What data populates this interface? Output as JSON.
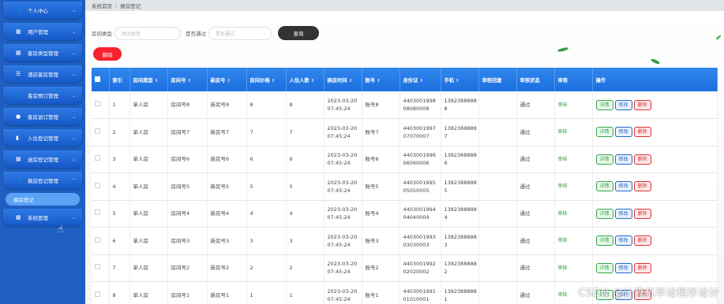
{
  "sidebar": {
    "items": [
      {
        "icon": "user-icon",
        "glyph": "👤",
        "label": "个人中心",
        "arrow": "⌄"
      },
      {
        "icon": "grid-icon",
        "glyph": "▦",
        "label": "用户管理",
        "arrow": "⌄"
      },
      {
        "icon": "grid-icon",
        "glyph": "▦",
        "label": "客房类型管理",
        "arrow": "⌄"
      },
      {
        "icon": "sliders-icon",
        "glyph": "☰",
        "label": "酒店客房管理",
        "arrow": "⌄"
      },
      {
        "icon": "user-icon",
        "glyph": "👤",
        "label": "客房预订管理",
        "arrow": "⌄"
      },
      {
        "icon": "location-pin-icon",
        "glyph": "●",
        "label": "客房退订管理",
        "arrow": "⌄"
      },
      {
        "icon": "document-icon",
        "glyph": "▮",
        "label": "入住登记管理",
        "arrow": "⌄"
      },
      {
        "icon": "grid-icon",
        "glyph": "▦",
        "label": "退房登记管理",
        "arrow": "⌄"
      },
      {
        "icon": "user-icon",
        "glyph": "👤",
        "label": "换房登记管理",
        "arrow": "⌃"
      }
    ],
    "submenu_active": "换房登记",
    "last_item": {
      "icon": "grid-icon",
      "glyph": "▦",
      "label": "系统管理",
      "arrow": "⌄"
    }
  },
  "breadcrumb": {
    "home": "系统首页",
    "sep": "/",
    "current": "换房登记"
  },
  "search": {
    "room_type_label": "房间类型",
    "room_type_placeholder": "房间类型",
    "passed_label": "是否通过",
    "passed_placeholder": "是否通过",
    "search_button": "查询"
  },
  "delete_button": "删除",
  "table": {
    "headers": [
      "索引",
      "房间类型",
      "房间号",
      "新房号",
      "房间价格",
      "入住人数",
      "换房时间",
      "账号",
      "身份证",
      "手机",
      "审核回复",
      "审核状态",
      "审核",
      "操作"
    ],
    "rows": [
      {
        "idx": "1",
        "type": "单人房",
        "room": "房间号8",
        "new_room": "新房号8",
        "price": "8",
        "people": "8",
        "time1": "2023-03-20",
        "time2": "07:45:24",
        "account": "账号8",
        "id1": "4403001998",
        "id2": "08080008",
        "phone1": "1382388888",
        "phone2": "8",
        "reply": "",
        "status": "通过",
        "audit": "审核"
      },
      {
        "idx": "2",
        "type": "单人房",
        "room": "房间号7",
        "new_room": "新房号7",
        "price": "7",
        "people": "7",
        "time1": "2023-03-20",
        "time2": "07:45:24",
        "account": "账号7",
        "id1": "4403001997",
        "id2": "07070007",
        "phone1": "1382388888",
        "phone2": "7",
        "reply": "",
        "status": "通过",
        "audit": "审核"
      },
      {
        "idx": "3",
        "type": "单人房",
        "room": "房间号6",
        "new_room": "新房号6",
        "price": "6",
        "people": "6",
        "time1": "2023-03-20",
        "time2": "07:45:24",
        "account": "账号6",
        "id1": "4403001996",
        "id2": "06060006",
        "phone1": "1382388888",
        "phone2": "6",
        "reply": "",
        "status": "通过",
        "audit": "审核"
      },
      {
        "idx": "4",
        "type": "单人房",
        "room": "房间号5",
        "new_room": "新房号5",
        "price": "5",
        "people": "5",
        "time1": "2023-03-20",
        "time2": "07:45:24",
        "account": "账号5",
        "id1": "4403001995",
        "id2": "05050005",
        "phone1": "1382388888",
        "phone2": "5",
        "reply": "",
        "status": "通过",
        "audit": "审核"
      },
      {
        "idx": "5",
        "type": "单人房",
        "room": "房间号4",
        "new_room": "新房号4",
        "price": "4",
        "people": "4",
        "time1": "2023-03-20",
        "time2": "07:45:24",
        "account": "账号4",
        "id1": "4403001994",
        "id2": "04040004",
        "phone1": "1382388888",
        "phone2": "4",
        "reply": "",
        "status": "通过",
        "audit": "审核"
      },
      {
        "idx": "6",
        "type": "单人房",
        "room": "房间号3",
        "new_room": "新房号3",
        "price": "3",
        "people": "3",
        "time1": "2023-03-20",
        "time2": "07:45:24",
        "account": "账号3",
        "id1": "4403001993",
        "id2": "03030003",
        "phone1": "1382388888",
        "phone2": "3",
        "reply": "",
        "status": "通过",
        "audit": "审核"
      },
      {
        "idx": "7",
        "type": "单人房",
        "room": "房间号2",
        "new_room": "新房号2",
        "price": "2",
        "people": "2",
        "time1": "2023-03-20",
        "time2": "07:45:24",
        "account": "账号2",
        "id1": "4403001992",
        "id2": "02020002",
        "phone1": "1382388888",
        "phone2": "2",
        "reply": "",
        "status": "通过",
        "audit": "审核"
      },
      {
        "idx": "8",
        "type": "单人房",
        "room": "房间号1",
        "new_room": "新房号1",
        "price": "1",
        "people": "1",
        "time1": "2023-03-20",
        "time2": "07:45:24",
        "account": "账号1",
        "id1": "4403001991",
        "id2": "01010001",
        "phone1": "1382388888",
        "phone2": "1",
        "reply": "",
        "status": "通过",
        "audit": "审核"
      }
    ],
    "op_detail": "详情",
    "op_edit": "修改",
    "op_delete": "删除",
    "sort_glyph": "⇕"
  },
  "watermark": "CSDN @计算机毕设程序设计",
  "colors": {
    "sidebar": "#1f5fc2",
    "header": "#2f86ec",
    "delete": "#f5222d",
    "search_btn": "#333333"
  }
}
